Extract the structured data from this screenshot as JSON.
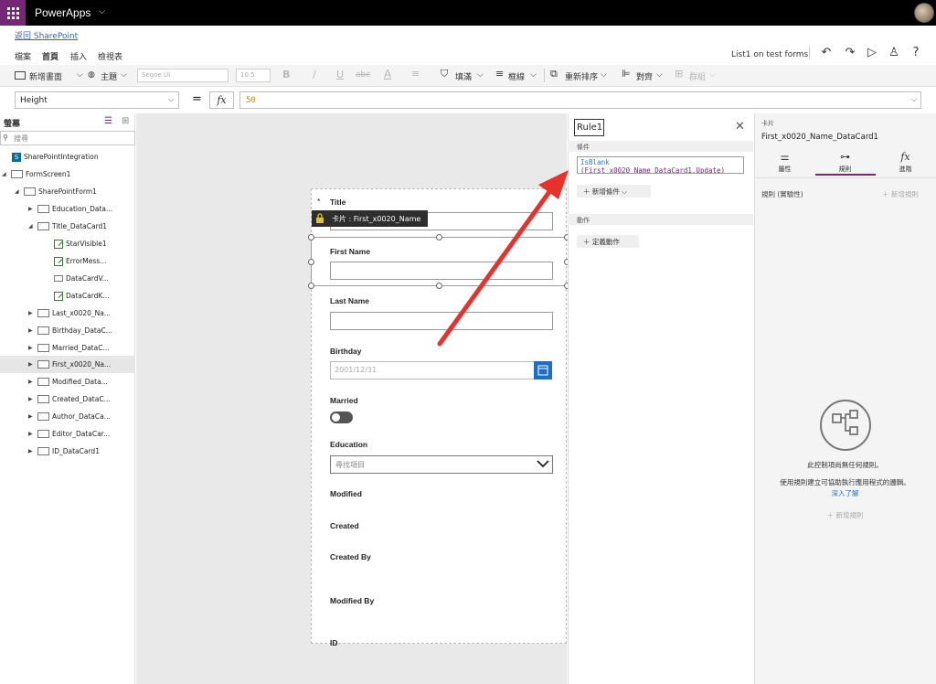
{
  "app": {
    "name": "PowerApps"
  },
  "back_link": "返回 SharePoint",
  "menu": {
    "tabs": [
      "檔案",
      "首頁",
      "插入",
      "檢視表"
    ],
    "doc_name": "List1 on test forms"
  },
  "ribbon": {
    "new_screen": "新增畫面",
    "theme": "主題",
    "font": "Segoe UI",
    "font_size": "10.5",
    "bold": "B",
    "italic": "/",
    "underline": "U",
    "strike": "abc",
    "font_color": "A",
    "fill": "填滿",
    "border": "框線",
    "reorder": "重新排序",
    "align": "對齊",
    "group": "群組"
  },
  "formula_bar": {
    "property": "Height",
    "equals": "=",
    "fx": "fx",
    "formula": "50"
  },
  "tree": {
    "title": "螢幕",
    "search_placeholder": "搜尋",
    "items": [
      {
        "label": "SharePointIntegration"
      },
      {
        "label": "FormScreen1"
      },
      {
        "label": "SharePointForm1"
      },
      {
        "label": "Education_Data..."
      },
      {
        "label": "Title_DataCard1"
      },
      {
        "label": "StarVisible1"
      },
      {
        "label": "ErrorMess..."
      },
      {
        "label": "DataCardV..."
      },
      {
        "label": "DataCardK..."
      },
      {
        "label": "Last_x0020_Na..."
      },
      {
        "label": "Birthday_DataC..."
      },
      {
        "label": "Married_DataC..."
      },
      {
        "label": "First_x0020_Na..."
      },
      {
        "label": "Modified_Data..."
      },
      {
        "label": "Created_DataC..."
      },
      {
        "label": "Author_DataCa..."
      },
      {
        "label": "Editor_DataCar..."
      },
      {
        "label": "ID_DataCard1"
      }
    ]
  },
  "form": {
    "title_star": "*",
    "title_label": "Title",
    "tooltip": "卡片 : First_x0020_Name",
    "first_name": "First Name",
    "last_name": "Last Name",
    "birthday": "Birthday",
    "birthday_placeholder": "2001/12/31",
    "married": "Married",
    "education": "Education",
    "education_placeholder": "尋找項目",
    "modified": "Modified",
    "created": "Created",
    "created_by": "Created By",
    "modified_by": "Modified By",
    "id": "ID"
  },
  "rule_panel": {
    "name": "Rule1",
    "condition_header": "條件",
    "condition_line1": "IsBlank",
    "condition_line2": "(First_x0020_Name_DataCard1.Update)",
    "add_condition": "新增條件",
    "action_header": "動作",
    "define_action": "定義動作"
  },
  "right_panel": {
    "caption": "卡片",
    "card_name": "First_x0020_Name_DataCard1",
    "tabs": [
      "屬性",
      "規則",
      "進階"
    ],
    "rules_preview": "規則 (實驗性)",
    "new_rule": "新增規則",
    "empty_title": "此控制項尚無任何規則。",
    "empty_desc": "使用規則建立可協助執行應用程式的邏輯。",
    "learn_more": "深入了解",
    "new_rule_bottom": "新增規則"
  },
  "colors": {
    "brand": "#742774",
    "accent_blue": "#1e6fc3",
    "annotation_arrow": "#e8312a"
  }
}
